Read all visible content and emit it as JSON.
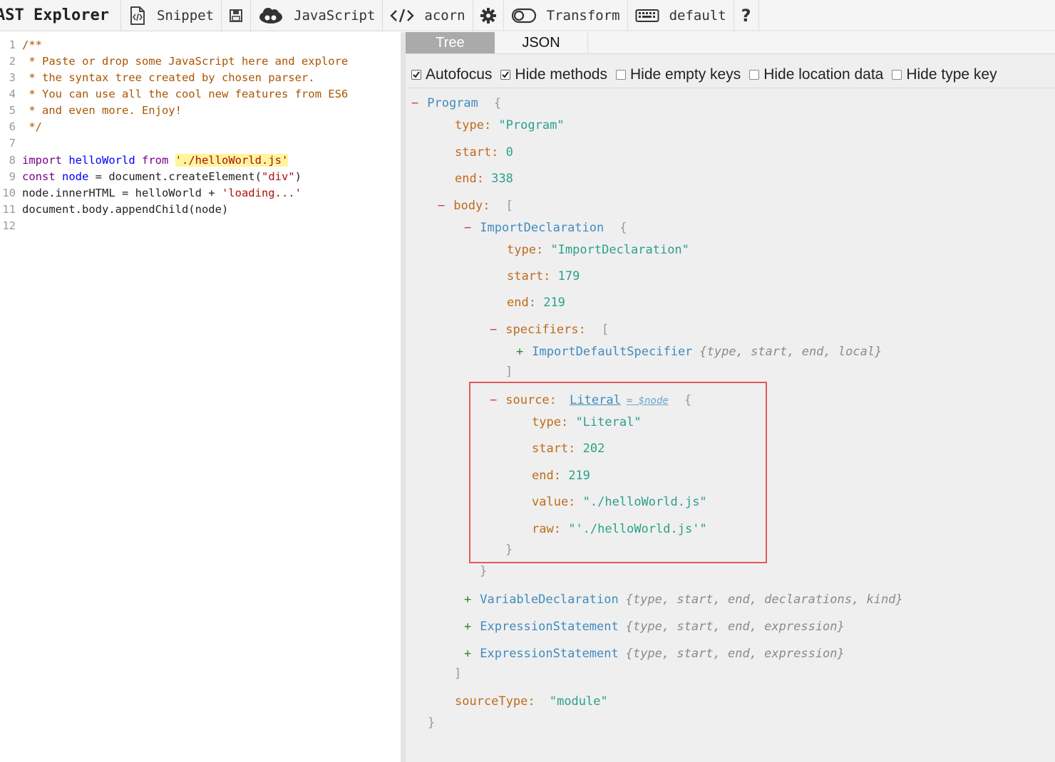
{
  "toolbar": {
    "title": "AST Explorer",
    "snippet_label": "Snippet",
    "language_label": "JavaScript",
    "parser_label": "acorn",
    "transform_label": "Transform",
    "keymap_label": "default",
    "help_label": "?"
  },
  "editor": {
    "lines": [
      {
        "num": "1"
      },
      {
        "num": "2"
      },
      {
        "num": "3"
      },
      {
        "num": "4"
      },
      {
        "num": "5"
      },
      {
        "num": "6"
      },
      {
        "num": "7"
      },
      {
        "num": "8"
      },
      {
        "num": "9"
      },
      {
        "num": "10"
      },
      {
        "num": "11"
      },
      {
        "num": "12"
      }
    ],
    "code": {
      "l1": "/**",
      "l2": " * Paste or drop some JavaScript here and explore",
      "l3": " * the syntax tree created by chosen parser.",
      "l4": " * You can use all the cool new features from ES6",
      "l5": " * and even more. Enjoy!",
      "l6": " */",
      "l8_kw1": "import",
      "l8_var": "helloWorld",
      "l8_kw2": "from",
      "l8_str": "'./helloWorld.js'",
      "l9_kw": "const",
      "l9_var": "node",
      "l9_rest1": " = document.createElement(",
      "l9_str": "\"div\"",
      "l9_rest2": ")",
      "l10_text": "node.innerHTML = helloWorld + ",
      "l10_str": "'loading...'",
      "l11_text": "document.body.appendChild(node)"
    }
  },
  "output": {
    "tabs": {
      "tree": "Tree",
      "json": "JSON"
    },
    "options": {
      "autofocus": "Autofocus",
      "hide_methods": "Hide methods",
      "hide_empty_keys": "Hide empty keys",
      "hide_location": "Hide location data",
      "hide_type_keys": "Hide type key"
    },
    "tree": {
      "program": "Program",
      "open_brace": "{",
      "close_brace": "}",
      "open_bracket": "[",
      "close_bracket": "]",
      "minus": "−",
      "plus": "+",
      "type_key": "type:",
      "start_key": "start:",
      "end_key": "end:",
      "body_key": "body:",
      "specifiers_key": "specifiers:",
      "source_key": "source:",
      "value_key": "value:",
      "raw_key": "raw:",
      "sourcetype_key": "sourceType:",
      "program_type": "\"Program\"",
      "program_start": "0",
      "program_end": "338",
      "import_decl": "ImportDeclaration",
      "import_type": "\"ImportDeclaration\"",
      "import_start": "179",
      "import_end": "219",
      "import_default_spec": "ImportDefaultSpecifier",
      "import_default_summary": "{type, start, end, local}",
      "literal": "Literal",
      "node_var": "= $node",
      "literal_type": "\"Literal\"",
      "literal_start": "202",
      "literal_end": "219",
      "literal_value": "\"./helloWorld.js\"",
      "literal_raw": "\"'./helloWorld.js'\"",
      "var_decl": "VariableDeclaration",
      "var_decl_summary": "{type, start, end, declarations, kind}",
      "expr_stmt_1": "ExpressionStatement",
      "expr_stmt_1_summary": "{type, start, end, expression}",
      "expr_stmt_2": "ExpressionStatement",
      "expr_stmt_2_summary": "{type, start, end, expression}",
      "source_type": "\"module\""
    }
  }
}
